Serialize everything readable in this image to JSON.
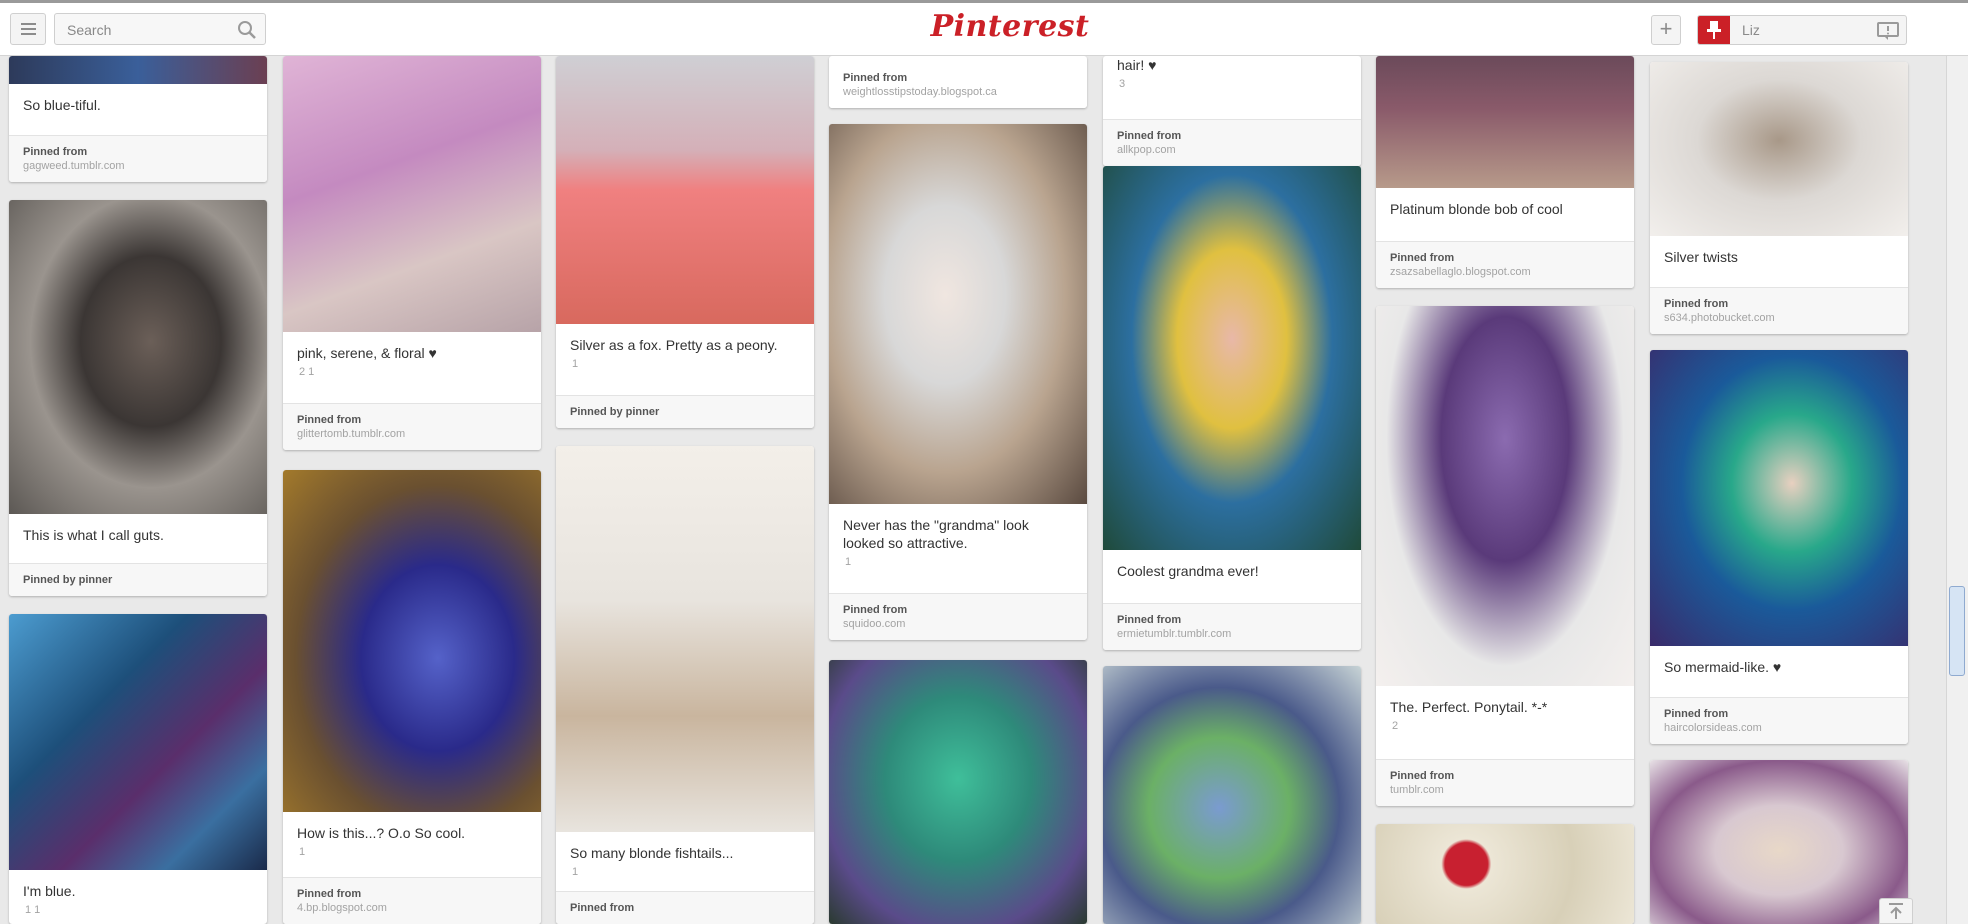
{
  "header": {
    "logo_text": "Pinterest",
    "search_placeholder": "Search",
    "add_label": "+",
    "user_name": "Liz",
    "brand_color": "#cb2027"
  },
  "pins": [
    {
      "description": "So blue-tiful.",
      "stats": "",
      "via_label": "Pinned from",
      "source": "gagweed.tumblr.com",
      "image_colors": [
        "#2d3a5a",
        "#3a5f9a",
        "#6b3f52"
      ]
    },
    {
      "description": "This is what I call guts.",
      "stats": "",
      "via_label": "Pinned by pinner",
      "source": "",
      "image_colors": [
        "#8d8a86",
        "#3b3634",
        "#d9d2cc"
      ]
    },
    {
      "description": "I'm blue.",
      "stats": "1 1",
      "via_label": "",
      "source": "",
      "image_colors": [
        "#1d4f7a",
        "#4c9cd0",
        "#5a2e6b"
      ]
    },
    {
      "description": "pink, serene, & floral ♥",
      "stats": "2 1",
      "via_label": "Pinned from",
      "source": "glittertomb.tumblr.com",
      "image_colors": [
        "#c48ac0",
        "#e0b4d6",
        "#b7a3a8"
      ]
    },
    {
      "description": "How is this...? O.o So cool.",
      "stats": "1",
      "via_label": "Pinned from",
      "source": "4.bp.blogspot.com",
      "image_colors": [
        "#a37a2b",
        "#2a2a8a",
        "#5562c9"
      ]
    },
    {
      "description": "Silver as a fox. Pretty as a peony.",
      "stats": "1",
      "via_label": "Pinned by pinner",
      "source": "",
      "image_colors": [
        "#cfcfd4",
        "#f08080",
        "#d8695e"
      ]
    },
    {
      "description": "So many blonde fishtails...",
      "stats": "1",
      "via_label": "Pinned from",
      "source": "",
      "image_colors": [
        "#e8e4de",
        "#c9b59e",
        "#f3efe9"
      ]
    },
    {
      "description": "",
      "stats": "",
      "via_label": "Pinned from",
      "source": "weightlosstipstoday.blogspot.ca",
      "image_colors": []
    },
    {
      "description": "Never has the \"grandma\" look looked so attractive.",
      "stats": "1",
      "via_label": "Pinned from",
      "source": "squidoo.com",
      "image_colors": [
        "#5a4a40",
        "#d8d8d8",
        "#b9a48f"
      ]
    },
    {
      "description": "",
      "stats": "",
      "via_label": "",
      "source": "",
      "image_colors": [
        "#2e8a7a",
        "#3fbf9a",
        "#5a4b8a"
      ]
    },
    {
      "description": "hair! ♥",
      "stats": "3",
      "via_label": "Pinned from",
      "source": "allkpop.com",
      "image_colors": []
    },
    {
      "description": "Coolest grandma ever!",
      "stats": "",
      "via_label": "Pinned from",
      "source": "ermietumblr.tumblr.com",
      "image_colors": [
        "#2c6fa0",
        "#e0c040",
        "#1f4a3a"
      ]
    },
    {
      "description": "",
      "stats": "",
      "via_label": "",
      "source": "",
      "image_colors": [
        "#7a9bd0",
        "#6bb066",
        "#c8d4d6"
      ]
    },
    {
      "description": "Platinum blonde bob of cool",
      "stats": "",
      "via_label": "Pinned from",
      "source": "zsazsabellaglo.blogspot.com",
      "image_colors": [
        "#6b4a5a",
        "#b79a8a",
        "#8a5a6a"
      ]
    },
    {
      "description": "The. Perfect. Ponytail. *-*",
      "stats": "2",
      "via_label": "Pinned from",
      "source": "tumblr.com",
      "image_colors": [
        "#e8e8e8",
        "#5a3a7a",
        "#8b6bb0"
      ]
    },
    {
      "description": "",
      "stats": "",
      "via_label": "",
      "source": "",
      "image_colors": [
        "#d8d0b8",
        "#c82030",
        "#ece6d6"
      ]
    },
    {
      "description": "Silver twists",
      "stats": "",
      "via_label": "Pinned from",
      "source": "s634.photobucket.com",
      "image_colors": [
        "#dcd8d4",
        "#a89888",
        "#f2efec"
      ]
    },
    {
      "description": "So mermaid-like. ♥",
      "stats": "",
      "via_label": "Pinned from",
      "source": "haircolorsideas.com",
      "image_colors": [
        "#1a5a9a",
        "#28a88a",
        "#3a2a6a"
      ]
    },
    {
      "description": "",
      "stats": "",
      "via_label": "",
      "source": "",
      "image_colors": [
        "#d8c8d0",
        "#8a5a8a",
        "#e8d8c8"
      ]
    }
  ]
}
